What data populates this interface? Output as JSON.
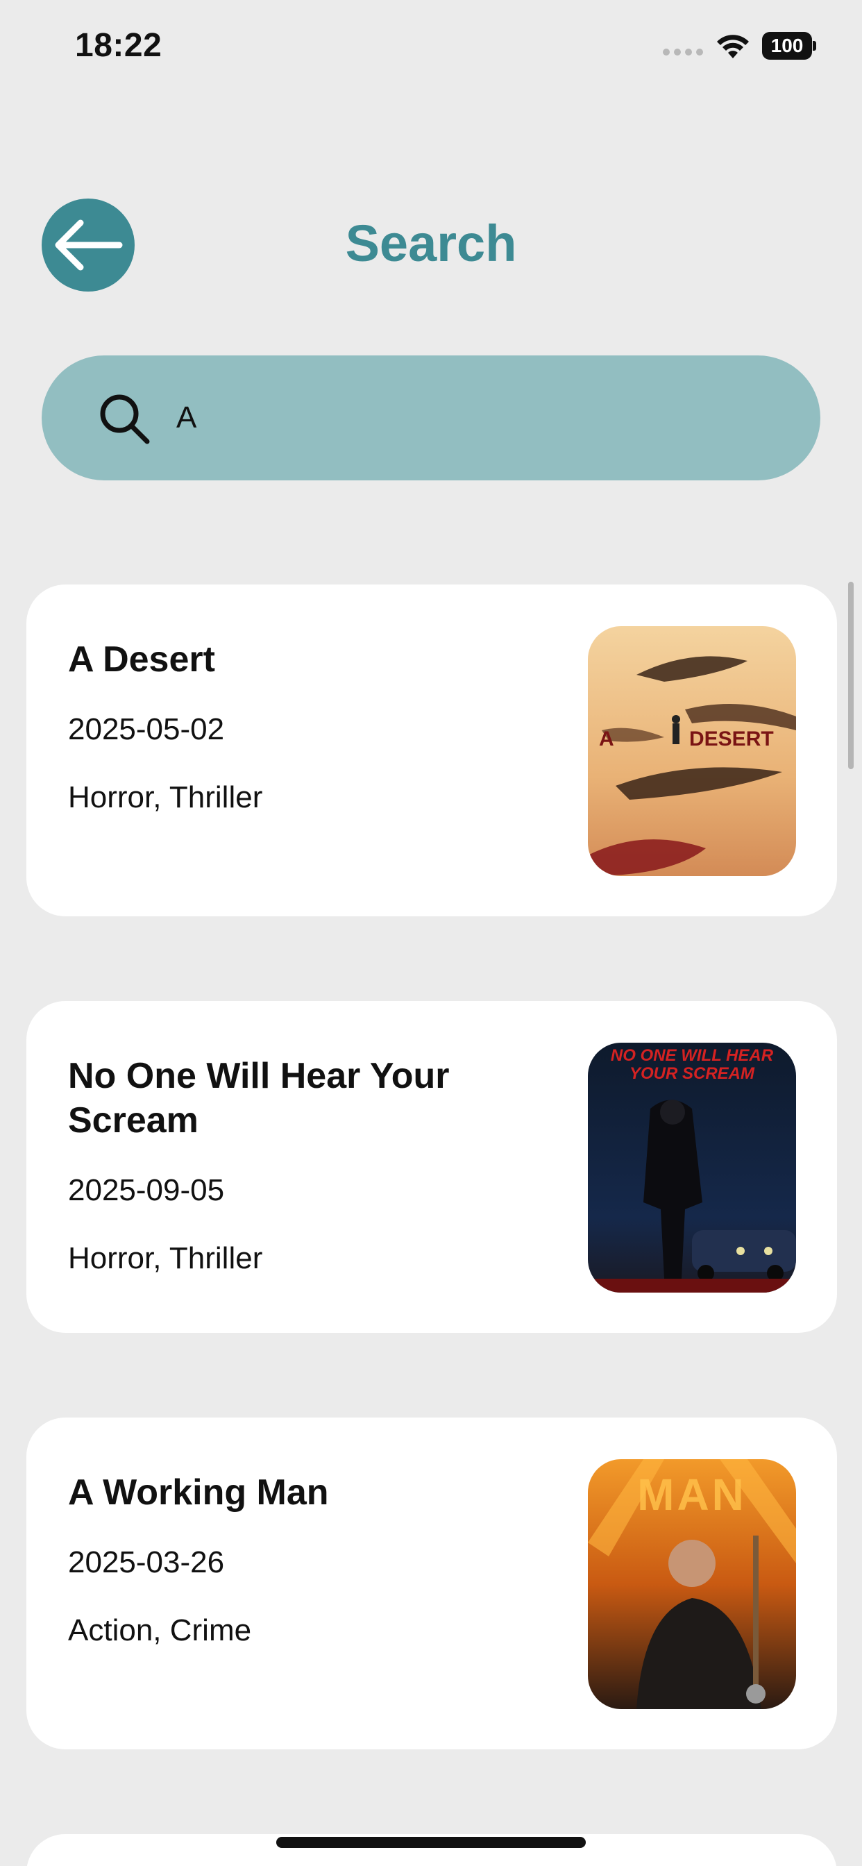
{
  "status_bar": {
    "time": "18:22",
    "battery": "100"
  },
  "header": {
    "title": "Search"
  },
  "search": {
    "value": "A",
    "placeholder": ""
  },
  "results": [
    {
      "title": "A Desert",
      "date": "2025-05-02",
      "genres": "Horror, Thriller",
      "poster_text_left": "A",
      "poster_text_right": "DESERT"
    },
    {
      "title": "No One Will Hear Your Scream",
      "date": "2025-09-05",
      "genres": "Horror, Thriller",
      "poster_text": "NO ONE WILL HEAR YOUR SCREAM"
    },
    {
      "title": "A Working Man",
      "date": "2025-03-26",
      "genres": "Action, Crime",
      "poster_text": "MAN"
    }
  ],
  "colors": {
    "accent": "#3d8a93",
    "search_bg": "#92bec1",
    "page_bg": "#ebebeb",
    "card_bg": "#ffffff"
  },
  "icons": {
    "back": "arrow-left-icon",
    "search": "search-icon",
    "wifi": "wifi-icon",
    "battery": "battery-icon"
  }
}
